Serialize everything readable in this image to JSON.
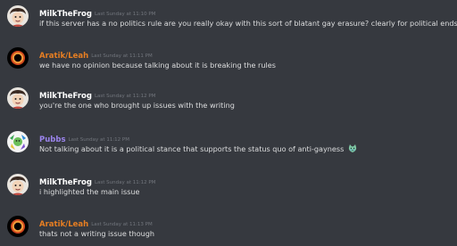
{
  "colors": {
    "background": "#36393f",
    "text": "#dcddde",
    "timestamp": "#72767d",
    "user_default": "#ffffff",
    "user_orange": "#e67e22",
    "user_purple": "#9b84ec"
  },
  "messages": [
    {
      "username": "MilkTheFrog",
      "timestamp": "Last Sunday at 11:10 PM",
      "text": "if this server has a no politics rule are you really okay with this sort of blatant gay erasure? clearly for political ends?",
      "avatar_icon": "frog-avatar-icon"
    },
    {
      "username": "Aratik/Leah",
      "timestamp": "Last Sunday at 11:11 PM",
      "text": "we have no opinion because talking about it is breaking the rules",
      "avatar_icon": "black-hole-avatar-icon"
    },
    {
      "username": "MilkTheFrog",
      "timestamp": "Last Sunday at 11:12 PM",
      "text": "you're the one who brought up issues with the writing",
      "avatar_icon": "frog-avatar-icon"
    },
    {
      "username": "Pubbs",
      "timestamp": "Last Sunday at 11:12 PM",
      "text": "Not talking about it is a political stance that supports the status quo of anti-gayness",
      "avatar_icon": "pubbs-avatar-icon",
      "emoji": "crying-cat-emoji-icon"
    },
    {
      "username": "MilkTheFrog",
      "timestamp": "Last Sunday at 11:12 PM",
      "text": "i highlighted the main issue",
      "avatar_icon": "frog-avatar-icon"
    },
    {
      "username": "Aratik/Leah",
      "timestamp": "Last Sunday at 11:13 PM",
      "text": "thats not a writing issue though",
      "avatar_icon": "black-hole-avatar-icon"
    }
  ]
}
